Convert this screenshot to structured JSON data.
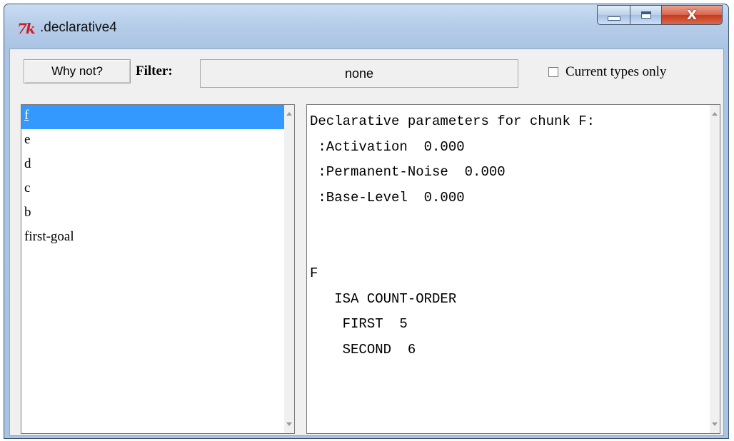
{
  "window": {
    "title": ".declarative4",
    "app_icon": "tk-feather-icon",
    "close_glyph": "X"
  },
  "toolbar": {
    "why_not_label": "Why not?",
    "filter_label": "Filter:",
    "filter_value": "none",
    "current_types_label": "Current types only",
    "current_types_checked": false
  },
  "chunk_list": {
    "items": [
      "f",
      "e",
      "d",
      "c",
      "b",
      "first-goal"
    ],
    "selected_index": 0
  },
  "detail": {
    "lines": [
      "Declarative parameters for chunk F:",
      " :Activation  0.000",
      " :Permanent-Noise  0.000",
      " :Base-Level  0.000",
      "",
      "",
      "F",
      "   ISA COUNT-ORDER",
      "    FIRST  5",
      "    SECOND  6"
    ]
  }
}
